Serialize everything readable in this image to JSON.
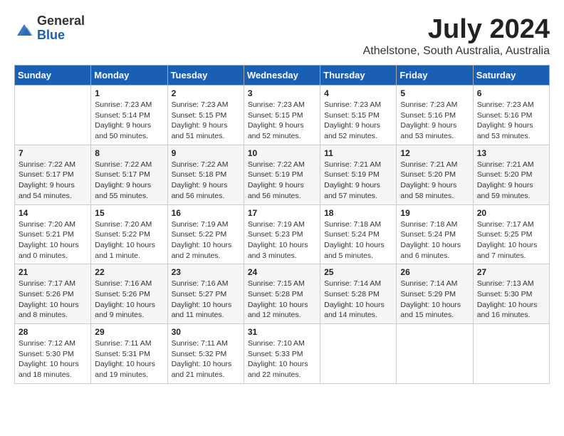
{
  "logo": {
    "general": "General",
    "blue": "Blue"
  },
  "title": "July 2024",
  "subtitle": "Athelstone, South Australia, Australia",
  "days_of_week": [
    "Sunday",
    "Monday",
    "Tuesday",
    "Wednesday",
    "Thursday",
    "Friday",
    "Saturday"
  ],
  "weeks": [
    [
      {
        "day": "",
        "info": ""
      },
      {
        "day": "1",
        "info": "Sunrise: 7:23 AM\nSunset: 5:14 PM\nDaylight: 9 hours\nand 50 minutes."
      },
      {
        "day": "2",
        "info": "Sunrise: 7:23 AM\nSunset: 5:15 PM\nDaylight: 9 hours\nand 51 minutes."
      },
      {
        "day": "3",
        "info": "Sunrise: 7:23 AM\nSunset: 5:15 PM\nDaylight: 9 hours\nand 52 minutes."
      },
      {
        "day": "4",
        "info": "Sunrise: 7:23 AM\nSunset: 5:15 PM\nDaylight: 9 hours\nand 52 minutes."
      },
      {
        "day": "5",
        "info": "Sunrise: 7:23 AM\nSunset: 5:16 PM\nDaylight: 9 hours\nand 53 minutes."
      },
      {
        "day": "6",
        "info": "Sunrise: 7:23 AM\nSunset: 5:16 PM\nDaylight: 9 hours\nand 53 minutes."
      }
    ],
    [
      {
        "day": "7",
        "info": "Sunrise: 7:22 AM\nSunset: 5:17 PM\nDaylight: 9 hours\nand 54 minutes."
      },
      {
        "day": "8",
        "info": "Sunrise: 7:22 AM\nSunset: 5:17 PM\nDaylight: 9 hours\nand 55 minutes."
      },
      {
        "day": "9",
        "info": "Sunrise: 7:22 AM\nSunset: 5:18 PM\nDaylight: 9 hours\nand 56 minutes."
      },
      {
        "day": "10",
        "info": "Sunrise: 7:22 AM\nSunset: 5:19 PM\nDaylight: 9 hours\nand 56 minutes."
      },
      {
        "day": "11",
        "info": "Sunrise: 7:21 AM\nSunset: 5:19 PM\nDaylight: 9 hours\nand 57 minutes."
      },
      {
        "day": "12",
        "info": "Sunrise: 7:21 AM\nSunset: 5:20 PM\nDaylight: 9 hours\nand 58 minutes."
      },
      {
        "day": "13",
        "info": "Sunrise: 7:21 AM\nSunset: 5:20 PM\nDaylight: 9 hours\nand 59 minutes."
      }
    ],
    [
      {
        "day": "14",
        "info": "Sunrise: 7:20 AM\nSunset: 5:21 PM\nDaylight: 10 hours\nand 0 minutes."
      },
      {
        "day": "15",
        "info": "Sunrise: 7:20 AM\nSunset: 5:22 PM\nDaylight: 10 hours\nand 1 minute."
      },
      {
        "day": "16",
        "info": "Sunrise: 7:19 AM\nSunset: 5:22 PM\nDaylight: 10 hours\nand 2 minutes."
      },
      {
        "day": "17",
        "info": "Sunrise: 7:19 AM\nSunset: 5:23 PM\nDaylight: 10 hours\nand 3 minutes."
      },
      {
        "day": "18",
        "info": "Sunrise: 7:18 AM\nSunset: 5:24 PM\nDaylight: 10 hours\nand 5 minutes."
      },
      {
        "day": "19",
        "info": "Sunrise: 7:18 AM\nSunset: 5:24 PM\nDaylight: 10 hours\nand 6 minutes."
      },
      {
        "day": "20",
        "info": "Sunrise: 7:17 AM\nSunset: 5:25 PM\nDaylight: 10 hours\nand 7 minutes."
      }
    ],
    [
      {
        "day": "21",
        "info": "Sunrise: 7:17 AM\nSunset: 5:26 PM\nDaylight: 10 hours\nand 8 minutes."
      },
      {
        "day": "22",
        "info": "Sunrise: 7:16 AM\nSunset: 5:26 PM\nDaylight: 10 hours\nand 9 minutes."
      },
      {
        "day": "23",
        "info": "Sunrise: 7:16 AM\nSunset: 5:27 PM\nDaylight: 10 hours\nand 11 minutes."
      },
      {
        "day": "24",
        "info": "Sunrise: 7:15 AM\nSunset: 5:28 PM\nDaylight: 10 hours\nand 12 minutes."
      },
      {
        "day": "25",
        "info": "Sunrise: 7:14 AM\nSunset: 5:28 PM\nDaylight: 10 hours\nand 14 minutes."
      },
      {
        "day": "26",
        "info": "Sunrise: 7:14 AM\nSunset: 5:29 PM\nDaylight: 10 hours\nand 15 minutes."
      },
      {
        "day": "27",
        "info": "Sunrise: 7:13 AM\nSunset: 5:30 PM\nDaylight: 10 hours\nand 16 minutes."
      }
    ],
    [
      {
        "day": "28",
        "info": "Sunrise: 7:12 AM\nSunset: 5:30 PM\nDaylight: 10 hours\nand 18 minutes."
      },
      {
        "day": "29",
        "info": "Sunrise: 7:11 AM\nSunset: 5:31 PM\nDaylight: 10 hours\nand 19 minutes."
      },
      {
        "day": "30",
        "info": "Sunrise: 7:11 AM\nSunset: 5:32 PM\nDaylight: 10 hours\nand 21 minutes."
      },
      {
        "day": "31",
        "info": "Sunrise: 7:10 AM\nSunset: 5:33 PM\nDaylight: 10 hours\nand 22 minutes."
      },
      {
        "day": "",
        "info": ""
      },
      {
        "day": "",
        "info": ""
      },
      {
        "day": "",
        "info": ""
      }
    ]
  ]
}
